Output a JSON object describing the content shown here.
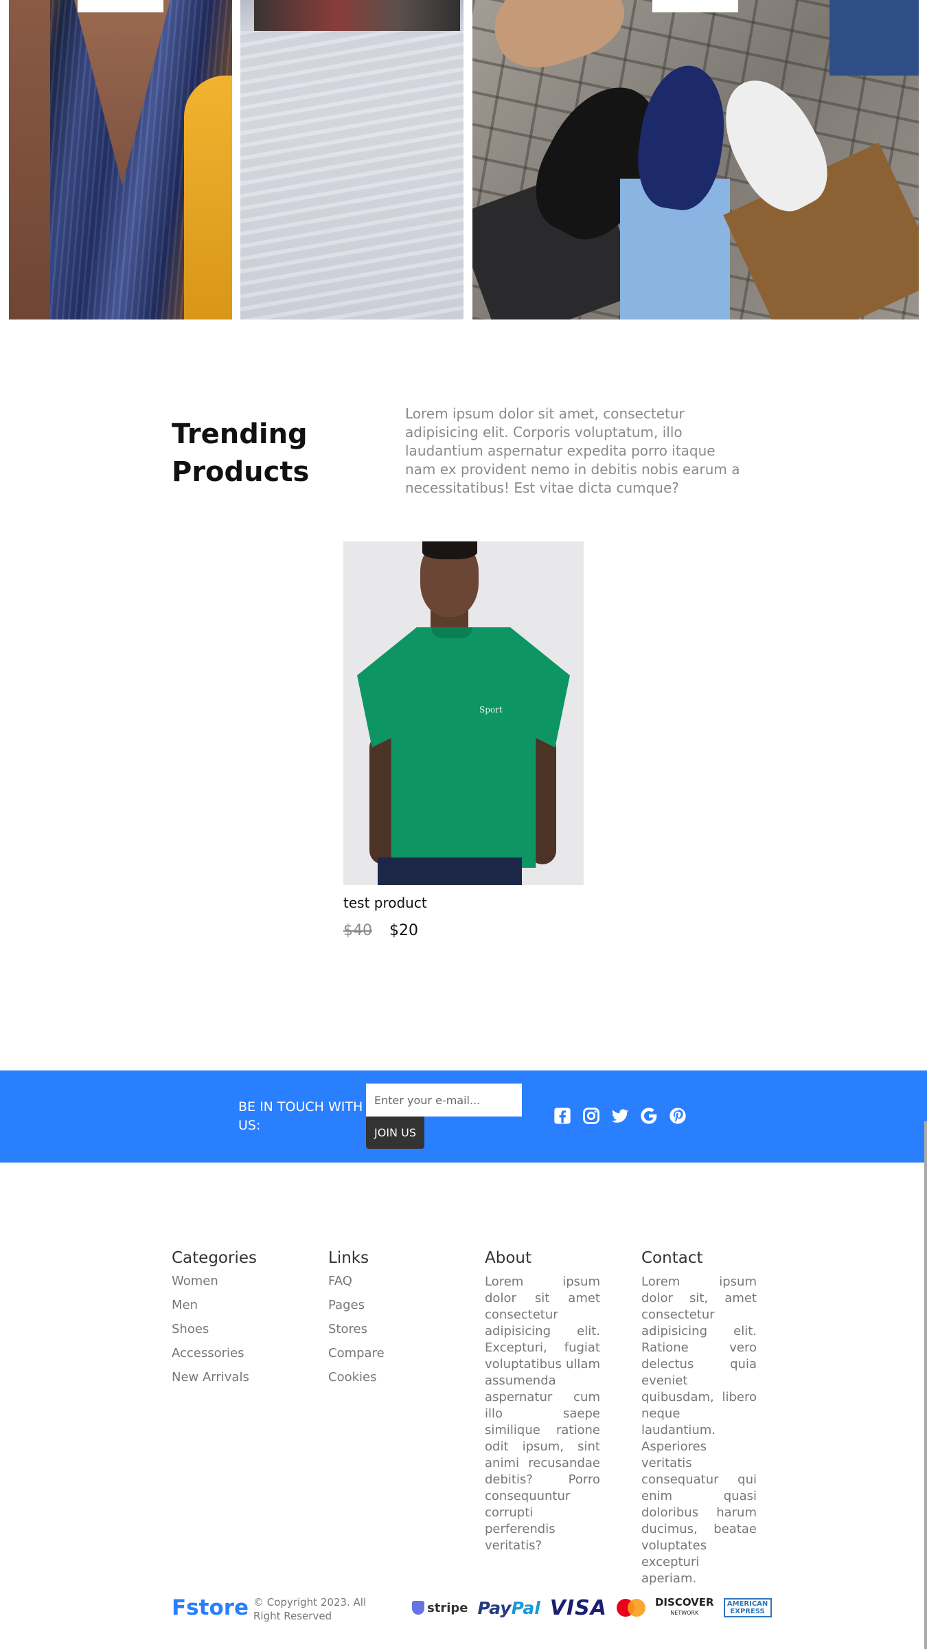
{
  "trending": {
    "title": "Trending Products",
    "description": "Lorem ipsum dolor sit amet, consectetur adipisicing elit. Corporis voluptatum, illo laudantium aspernatur expedita porro itaque nam ex provident nemo in debitis nobis earum a necessitatibus! Est vitae dicta cumque?"
  },
  "product": {
    "name": "test product",
    "old_price": "$40",
    "new_price": "$20",
    "shirt_logo": "Sport"
  },
  "newsletter": {
    "label": "BE IN TOUCH WITH US:",
    "placeholder": "Enter your e-mail...",
    "button": "JOIN US",
    "background": "#2a7fff",
    "social_icons": [
      "facebook-icon",
      "instagram-icon",
      "twitter-icon",
      "google-icon",
      "pinterest-icon"
    ]
  },
  "footer": {
    "categories": {
      "title": "Categories",
      "items": [
        "Women",
        "Men",
        "Shoes",
        "Accessories",
        "New Arrivals"
      ]
    },
    "links": {
      "title": "Links",
      "items": [
        "FAQ",
        "Pages",
        "Stores",
        "Compare",
        "Cookies"
      ]
    },
    "about": {
      "title": "About",
      "text": "Lorem ipsum dolor sit amet consectetur adipisicing elit. Excepturi, fugiat voluptatibus ullam assumenda aspernatur cum illo saepe similique ratione odit ipsum, sint animi recusandae debitis? Porro consequuntur corrupti perferendis veritatis?"
    },
    "contact": {
      "title": "Contact",
      "text": "Lorem ipsum dolor sit, amet consectetur adipisicing elit. Ratione vero delectus quia eveniet quibusdam, libero neque laudantium. Asperiores veritatis consequatur qui enim quasi doloribus harum ducimus, beatae voluptates excepturi aperiam."
    }
  },
  "bottom": {
    "brand": "Fstore",
    "brand_color": "#2a7fff",
    "copyright": "© Copyright 2023. All Right Reserved",
    "payments": {
      "stripe": "stripe",
      "paypal_1": "Pay",
      "paypal_2": "Pal",
      "visa": "VISA",
      "discover": "DISCOVER",
      "discover_sub": "NETWORK",
      "amex_1": "AMERICAN",
      "amex_2": "EXPRESS"
    }
  }
}
